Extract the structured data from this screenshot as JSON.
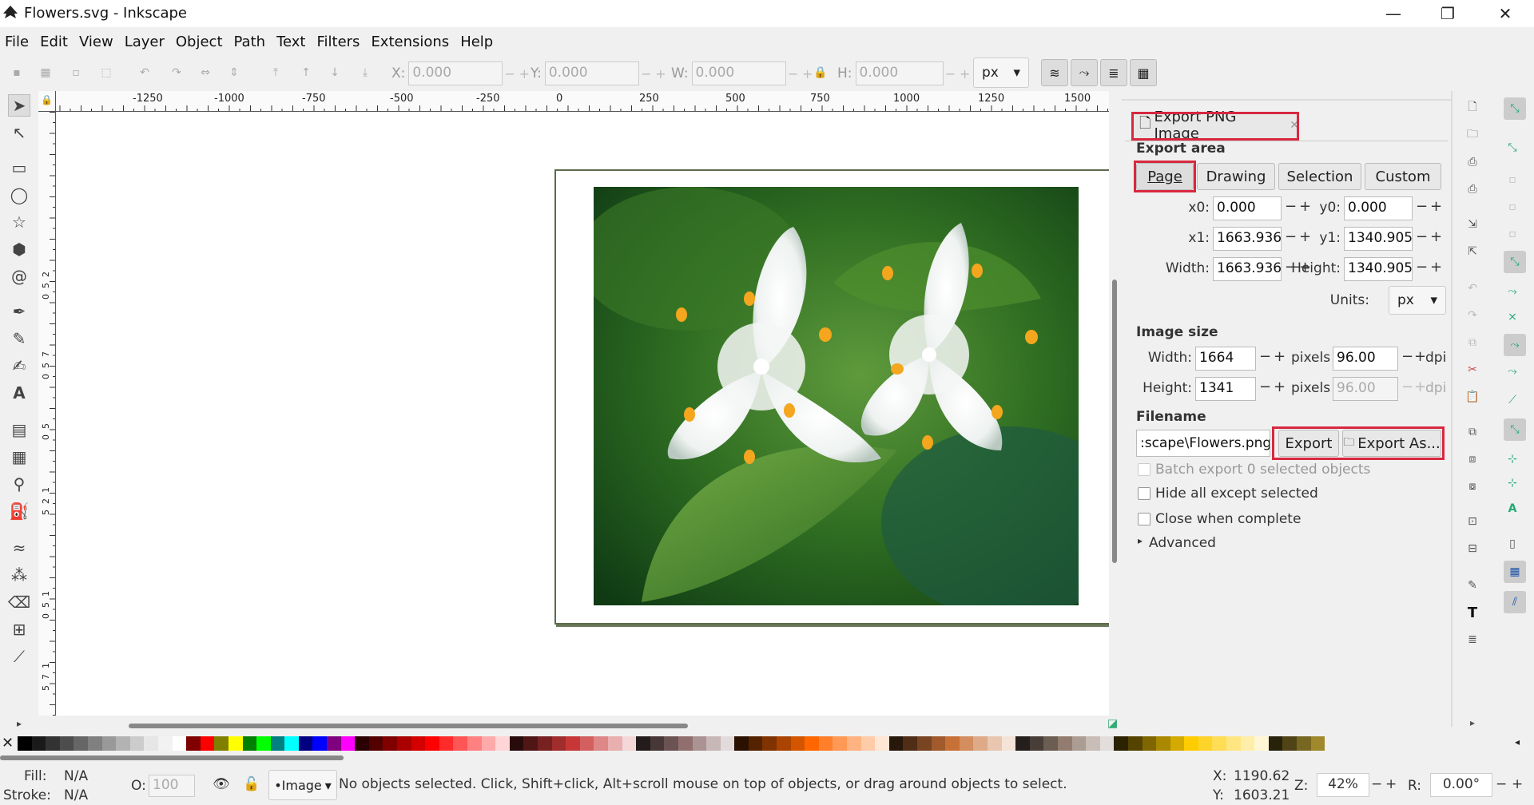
{
  "window": {
    "title": "Flowers.svg - Inkscape",
    "minimize": "—",
    "maximize": "❐",
    "close": "✕"
  },
  "menu": [
    "File",
    "Edit",
    "View",
    "Layer",
    "Object",
    "Path",
    "Text",
    "Filters",
    "Extensions",
    "Help"
  ],
  "toolbar": {
    "x_label": "X:",
    "x_value": "0.000",
    "y_label": "Y:",
    "y_value": "0.000",
    "w_label": "W:",
    "w_value": "0.000",
    "h_label": "H:",
    "h_value": "0.000",
    "unit": "px",
    "spin_minus": "−",
    "spin_plus": "+"
  },
  "ruler": {
    "h_ticks": [
      "-1250",
      "-1000",
      "-750",
      "-500",
      "-250",
      "0",
      "250",
      "500",
      "750",
      "1000",
      "1250",
      "1500"
    ],
    "v_ticks": [
      "0",
      "2",
      "5",
      "0",
      "7",
      "5",
      "0",
      "5",
      "0",
      "1",
      "2",
      "5",
      "1",
      "5",
      "0",
      "1",
      "7",
      "5"
    ]
  },
  "export_panel": {
    "tab_label": "Export PNG Image",
    "tab_close": "✕",
    "export_area_heading": "Export area",
    "area_buttons": [
      "Page",
      "Drawing",
      "Selection",
      "Custom"
    ],
    "x0_label": "x0:",
    "x0_value": "0.000",
    "y0_label": "y0:",
    "y0_value": "0.000",
    "x1_label": "x1:",
    "x1_value": "1663.936",
    "y1_label": "y1:",
    "y1_value": "1340.905",
    "width_label": "Width:",
    "width_value": "1663.936",
    "height_label": "Height:",
    "height_value": "1340.905",
    "units_label": "Units:",
    "units_value": "px",
    "image_size_heading": "Image size",
    "img_width_label": "Width:",
    "img_width_value": "1664",
    "img_height_label": "Height:",
    "img_height_value": "1341",
    "pixels_at": "pixels at",
    "dpi_value": "96.00",
    "dpi_value_disabled": "96.00",
    "dpi_label": "dpi",
    "filename_heading": "Filename",
    "filename_value": ":scape\\Flowers.png",
    "export_button": "Export",
    "export_as_button": "Export As...",
    "batch_export": "Batch export 0 selected objects",
    "hide_all": "Hide all except selected",
    "close_when_complete": "Close when complete",
    "advanced": "Advanced"
  },
  "palette_colors": [
    "#000000",
    "#1a1a1a",
    "#333333",
    "#4d4d4d",
    "#666666",
    "#808080",
    "#999999",
    "#b3b3b3",
    "#cccccc",
    "#e6e6e6",
    "#f2f2f2",
    "#ffffff",
    "#800000",
    "#ff0000",
    "#808000",
    "#ffff00",
    "#008000",
    "#00ff00",
    "#008080",
    "#00ffff",
    "#000080",
    "#0000ff",
    "#800080",
    "#ff00ff",
    "#2b0000",
    "#550000",
    "#800000",
    "#aa0000",
    "#d40000",
    "#ff0000",
    "#ff2a2a",
    "#ff5555",
    "#ff8080",
    "#ffaaaa",
    "#ffd5d5",
    "#280b0b",
    "#501616",
    "#782121",
    "#a02c2c",
    "#c83737",
    "#d35f5f",
    "#de8787",
    "#e9afaf",
    "#f4d7d7",
    "#241c1c",
    "#483737",
    "#6c5353",
    "#916f6f",
    "#ac9393",
    "#c8b7b7",
    "#e3dbdb",
    "#2b1100",
    "#552200",
    "#803300",
    "#aa4400",
    "#d45500",
    "#ff6600",
    "#ff7f2a",
    "#ff9955",
    "#ffb380",
    "#ffccaa",
    "#ffe6d5",
    "#28170b",
    "#502d16",
    "#784421",
    "#a05a2c",
    "#c87137",
    "#d38d5f",
    "#deaa87",
    "#e9c6af",
    "#f4e3d7",
    "#241f1c",
    "#483e37",
    "#6c5d53",
    "#917c6f",
    "#ac9d93",
    "#c8beb7",
    "#e3dedb",
    "#2b2200",
    "#554400",
    "#806600",
    "#aa8800",
    "#d4aa00",
    "#ffcc00",
    "#ffd42a",
    "#ffdd55",
    "#ffe680",
    "#ffeeaa",
    "#fff6d5",
    "#28220b",
    "#504416",
    "#786721",
    "#a0892c"
  ],
  "status": {
    "fill_label": "Fill:",
    "fill_value": "N/A",
    "stroke_label": "Stroke:",
    "stroke_value": "N/A",
    "opacity_label": "O:",
    "opacity_value": "100",
    "layer": "•Image",
    "message": "No objects selected. Click, Shift+click, Alt+scroll mouse on top of objects, or drag around objects to select.",
    "x_label": "X:",
    "x_value": "1190.62",
    "y_label": "Y:",
    "y_value": "1603.21",
    "zoom_label": "Z:",
    "zoom_value": "42%",
    "rotate_label": "R:",
    "rotate_value": "0.00°"
  }
}
